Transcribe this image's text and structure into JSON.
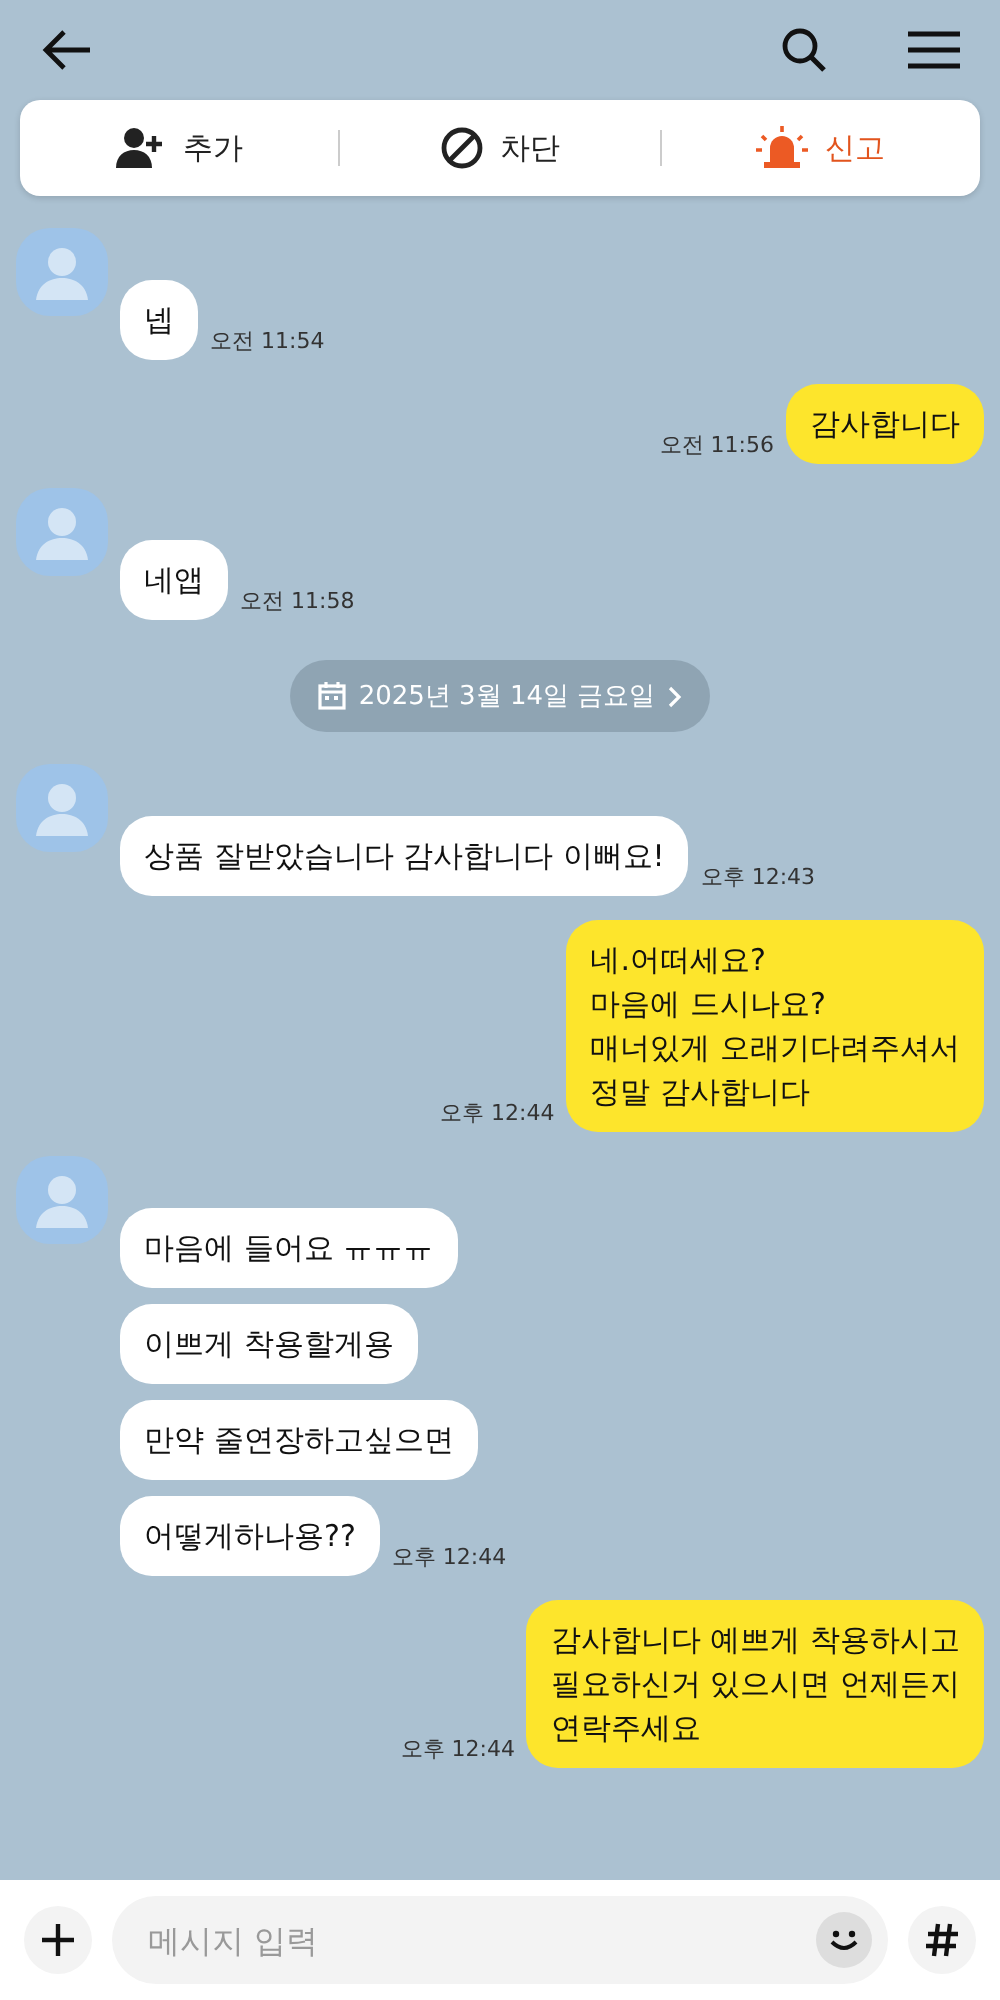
{
  "actions": [
    {
      "kind": "add",
      "label": "추가"
    },
    {
      "kind": "block",
      "label": "차단"
    },
    {
      "kind": "report",
      "label": "신고"
    }
  ],
  "messages": [
    {
      "kind": "received",
      "bubbles": [
        "넵"
      ],
      "time": "오전 11:54"
    },
    {
      "kind": "sent",
      "bubbles": [
        "감사합니다"
      ],
      "time": "오전 11:56"
    },
    {
      "kind": "received",
      "bubbles": [
        "네앱"
      ],
      "time": "오전 11:58"
    },
    {
      "kind": "date",
      "text": "2025년 3월 14일 금요일"
    },
    {
      "kind": "received",
      "bubbles": [
        "상품 잘받았습니다 감사합니다 이뻐요!"
      ],
      "time": "오후 12:43"
    },
    {
      "kind": "sent",
      "bubbles": [
        "네.어떠세요?\n마음에 드시나요?\n매너있게 오래기다려주셔서\n정말 감사합니다"
      ],
      "time": "오후 12:44"
    },
    {
      "kind": "received",
      "bubbles": [
        "마음에 들어요 ㅠㅠㅠ",
        "이쁘게 착용할게용",
        "만약 줄연장하고싶으면",
        "어떻게하나용??"
      ],
      "time": "오후 12:44"
    },
    {
      "kind": "sent",
      "bubbles": [
        "감사합니다 예쁘게 착용하시고\n필요하신거 있으시면 언제든지\n연락주세요"
      ],
      "time": "오후 12:44"
    }
  ],
  "input": {
    "placeholder": "메시지 입력"
  }
}
